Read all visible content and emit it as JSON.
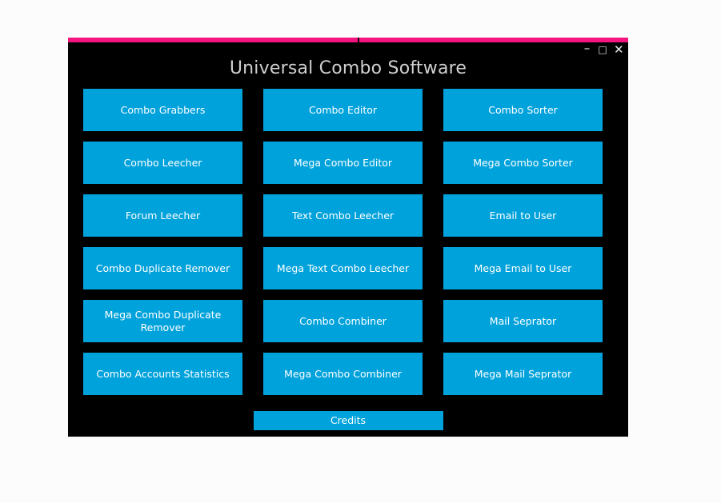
{
  "window": {
    "title": "Universal Combo Software",
    "accent_color": "#f5157f",
    "background_color": "#000000",
    "button_color": "#00a2db",
    "title_color": "#cfcfcf",
    "controls": {
      "minimize_label": "–",
      "maximize_label": "□",
      "close_label": "✕"
    }
  },
  "grid": {
    "buttons": [
      {
        "label": "Combo Grabbers"
      },
      {
        "label": "Combo Editor"
      },
      {
        "label": "Combo Sorter"
      },
      {
        "label": "Combo Leecher"
      },
      {
        "label": "Mega Combo Editor"
      },
      {
        "label": "Mega Combo Sorter"
      },
      {
        "label": "Forum Leecher"
      },
      {
        "label": "Text Combo Leecher"
      },
      {
        "label": "Email to User"
      },
      {
        "label": "Combo Duplicate Remover"
      },
      {
        "label": "Mega Text Combo Leecher"
      },
      {
        "label": "Mega Email to User"
      },
      {
        "label": "Mega Combo Duplicate Remover"
      },
      {
        "label": "Combo Combiner"
      },
      {
        "label": "Mail Seprator"
      },
      {
        "label": "Combo Accounts Statistics"
      },
      {
        "label": "Mega Combo Combiner"
      },
      {
        "label": "Mega Mail Seprator"
      }
    ]
  },
  "footer": {
    "credits_label": "Credits"
  }
}
